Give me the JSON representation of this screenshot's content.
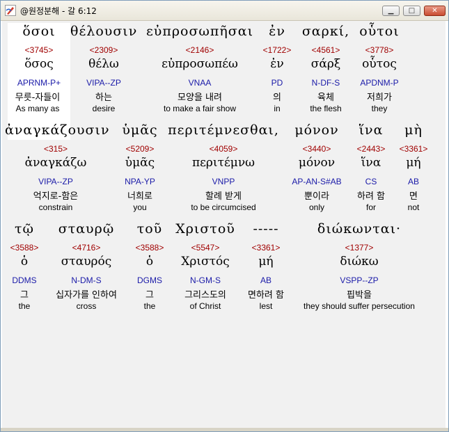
{
  "window": {
    "title": "@원정분해 - 갈 6:12"
  },
  "titlebar": {
    "minimize_symbol": "▁",
    "maximize_symbol": "□",
    "close_symbol": "✕",
    "app_icon": "app-logo-icon"
  },
  "rows": [
    {
      "words": [
        {
          "greek": "ὅσοι",
          "strong": "<3745>",
          "lemma": "ὅσος",
          "parse": "APRNM-P+",
          "korean": "무릇-자들이",
          "english": "As many as"
        },
        {
          "greek": "θέλουσιν",
          "strong": "<2309>",
          "lemma": "θέλω",
          "parse": "VIPA--ZP",
          "korean": "하는",
          "english": "desire"
        },
        {
          "greek": "εὐπροσωπῆσαι",
          "strong": "<2146>",
          "lemma": "εὐπροσωπέω",
          "parse": "VNAA",
          "korean": "모양을 내려",
          "english": "to make a fair show"
        },
        {
          "greek": "ἐν",
          "strong": "<1722>",
          "lemma": "ἐν",
          "parse": "PD",
          "korean": "의",
          "english": "in"
        },
        {
          "greek": "σαρκί,",
          "strong": "<4561>",
          "lemma": "σάρξ",
          "parse": "N-DF-S",
          "korean": "육체",
          "english": "the flesh"
        },
        {
          "greek": "οὗτοι",
          "strong": "<3778>",
          "lemma": "οὗτος",
          "parse": "APDNM-P",
          "korean": "저희가",
          "english": "they"
        }
      ]
    },
    {
      "words": [
        {
          "greek": "ἀναγκάζουσιν",
          "strong": "<315>",
          "lemma": "ἀναγκάζω",
          "parse": "VIPA--ZP",
          "korean": "억지로-함은",
          "english": "constrain"
        },
        {
          "greek": "ὑμᾶς",
          "strong": "<5209>",
          "lemma": "ὑμᾶς",
          "parse": "NPA-YP",
          "korean": "너희로",
          "english": "you"
        },
        {
          "greek": "περιτέμνεσθαι,",
          "strong": "<4059>",
          "lemma": "περιτέμνω",
          "parse": "VNPP",
          "korean": "할례 받게",
          "english": "to be circumcised"
        },
        {
          "greek": "μόνον",
          "strong": "<3440>",
          "lemma": "μόνον",
          "parse": "AP-AN-S#AB",
          "korean": "뿐이라",
          "english": "only"
        },
        {
          "greek": "ἵνα",
          "strong": "<2443>",
          "lemma": "ἵνα",
          "parse": "CS",
          "korean": "하려 함",
          "english": "for"
        },
        {
          "greek": "μὴ",
          "strong": "<3361>",
          "lemma": "μή",
          "parse": "AB",
          "korean": "면",
          "english": "not"
        }
      ]
    },
    {
      "words": [
        {
          "greek": "τῷ",
          "strong": "<3588>",
          "lemma": "ὁ",
          "parse": "DDMS",
          "korean": "그",
          "english": "the"
        },
        {
          "greek": "σταυρῷ",
          "strong": "<4716>",
          "lemma": "σταυρός",
          "parse": "N-DM-S",
          "korean": "십자가를 인하여",
          "english": "cross"
        },
        {
          "greek": "τοῦ",
          "strong": "<3588>",
          "lemma": "ὁ",
          "parse": "DGMS",
          "korean": "그",
          "english": "the"
        },
        {
          "greek": "Χριστοῦ",
          "strong": "<5547>",
          "lemma": "Χριστός",
          "parse": "N-GM-S",
          "korean": "그리스도의",
          "english": "of Christ"
        },
        {
          "greek": "-----",
          "strong": "<3361>",
          "lemma": "μή",
          "parse": "AB",
          "korean": "면하려 함",
          "english": "lest"
        },
        {
          "greek": "διώκωνται·",
          "strong": "<1377>",
          "lemma": "διώκω",
          "parse": "VSPP--ZP",
          "korean": "핍박을",
          "english": "they should suffer persecution"
        }
      ]
    }
  ]
}
